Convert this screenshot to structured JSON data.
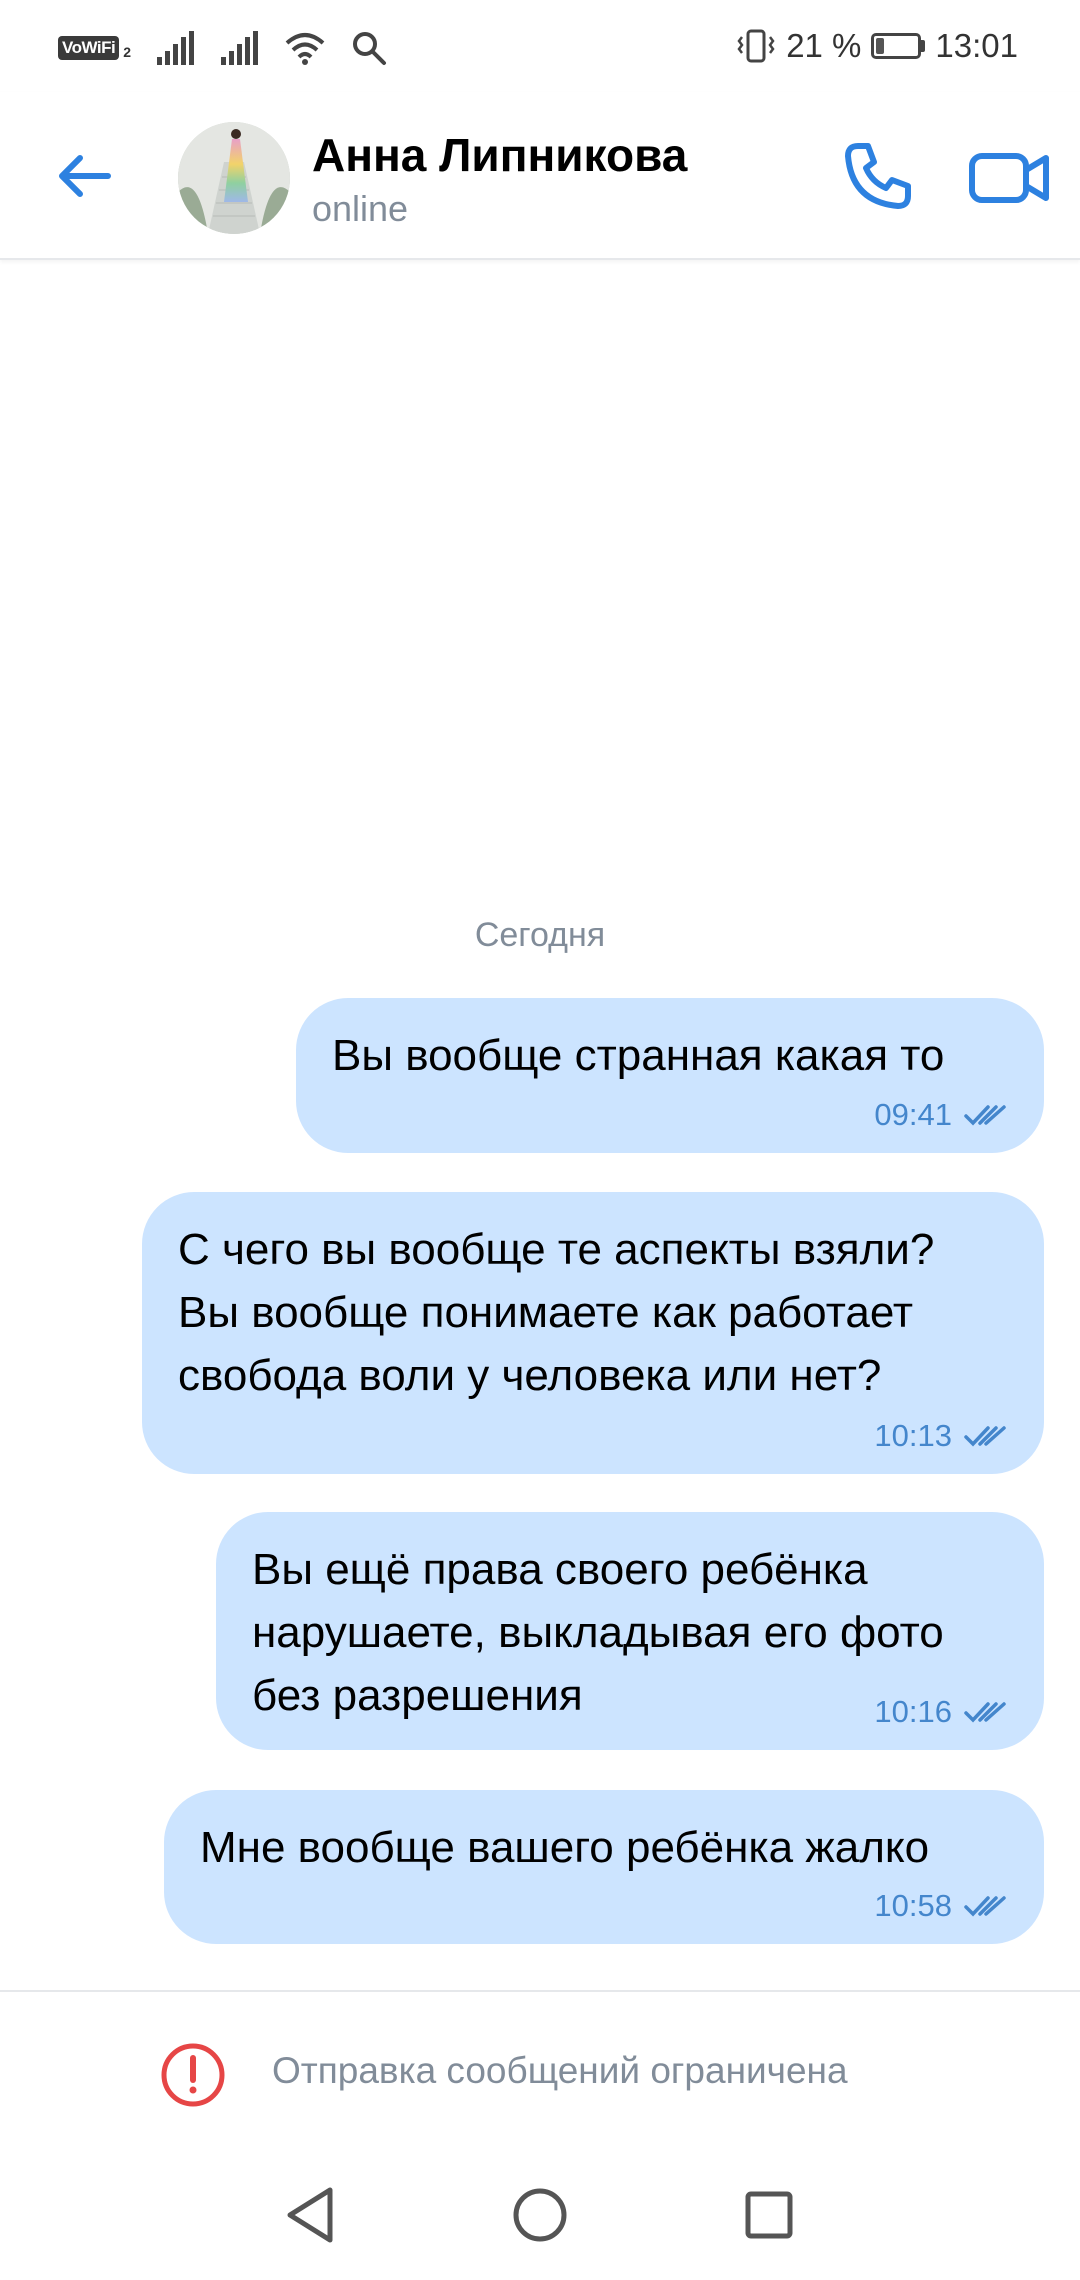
{
  "status_bar": {
    "vowifi_label": "VoWiFi",
    "vowifi_sim": "2",
    "battery_text": "21 %",
    "battery_level": 0.21,
    "time": "13:01"
  },
  "header": {
    "name": "Анна Липникова",
    "status": "online"
  },
  "chat": {
    "date_separator": "Сегодня",
    "messages": [
      {
        "text": "Вы вообще странная какая то",
        "time": "09:41"
      },
      {
        "text": "С чего вы вообще те аспекты взяли?\nВы вообще понимаете как работает\nсвобода воли у человека или нет?",
        "time": "10:13"
      },
      {
        "text": "Вы ещё права своего ребёнка\nнарушаете, выкладывая его фото\nбез разрешения",
        "time": "10:16"
      },
      {
        "text": "Мне вообще вашего ребёнка жалко",
        "time": "10:58"
      }
    ]
  },
  "composer": {
    "restricted_text": "Отправка сообщений ограничена"
  },
  "colors": {
    "accent": "#2d81e0",
    "bubble": "#cce4ff",
    "meta": "#4486cc",
    "secondary_text": "#818c99",
    "warning": "#e64646"
  },
  "icons": {
    "back": "arrow-left-icon",
    "call": "phone-icon",
    "video": "video-camera-icon",
    "read": "double-check-icon",
    "warning": "exclamation-circle-icon",
    "nav_back": "triangle-back-icon",
    "nav_home": "circle-home-icon",
    "nav_recents": "square-recents-icon"
  }
}
